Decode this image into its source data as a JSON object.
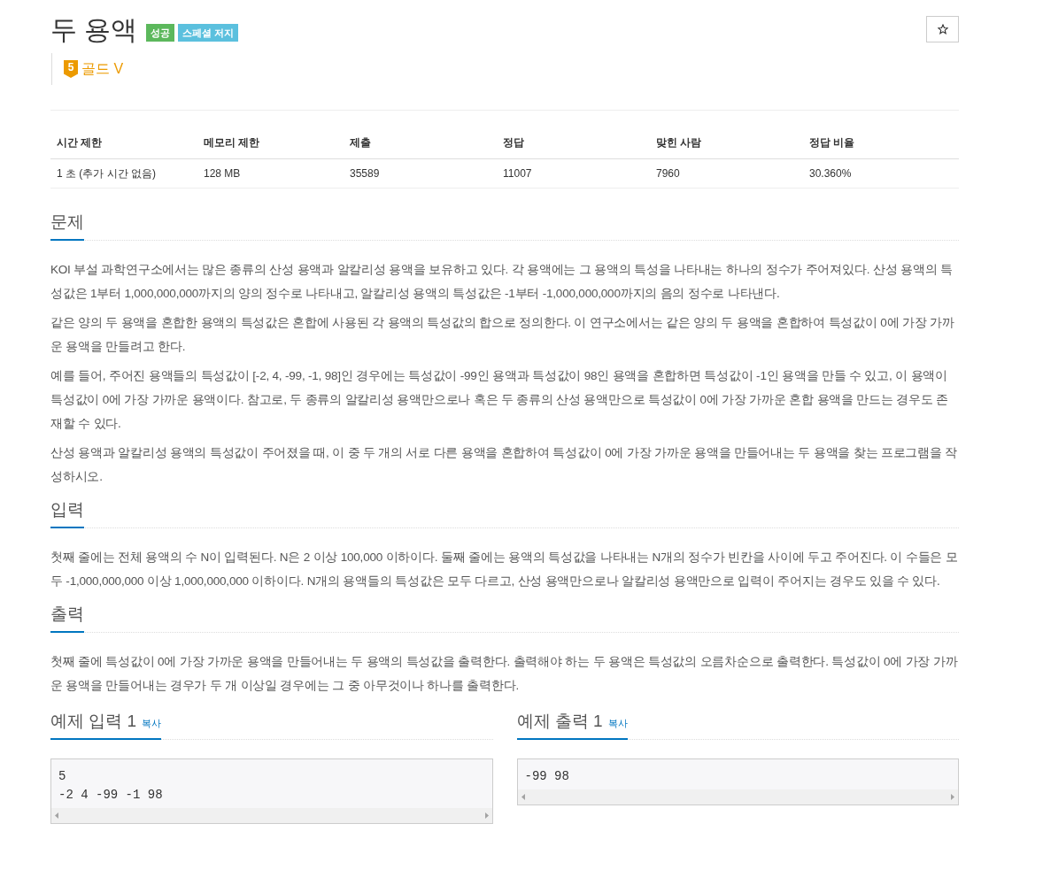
{
  "problem": {
    "title": "두 용액",
    "labels": [
      {
        "text": "성공",
        "color": "#5cb85c"
      },
      {
        "text": "스페셜 저지",
        "color": "#5bc0de"
      }
    ],
    "tier": {
      "number": "5",
      "name": "골드 V"
    },
    "starred": false
  },
  "info_table": {
    "columns": [
      "시간 제한",
      "메모리 제한",
      "제출",
      "정답",
      "맞힌 사람",
      "정답 비율"
    ],
    "rows": [
      [
        "1 초 (추가 시간 없음)",
        "128 MB",
        "35589",
        "11007",
        "7960",
        "30.360%"
      ]
    ]
  },
  "sections": [
    {
      "heading": "문제",
      "paragraphs": [
        "KOI 부설 과학연구소에서는 많은 종류의 산성 용액과 알칼리성 용액을 보유하고 있다. 각 용액에는 그 용액의 특성을 나타내는 하나의 정수가 주어져있다.  산성 용액의 특성값은 1부터 1,000,000,000까지의 양의 정수로 나타내고, 알칼리성 용액의 특성값은 -1부터 -1,000,000,000까지의 음의 정수로 나타낸다.",
        "같은 양의 두 용액을 혼합한 용액의 특성값은 혼합에 사용된 각 용액의 특성값의 합으로 정의한다. 이 연구소에서는 같은 양의 두 용액을 혼합하여 특성값이 0에 가장 가까운 용액을 만들려고 한다.",
        "예를 들어, 주어진 용액들의 특성값이 [-2, 4, -99, -1, 98]인 경우에는 특성값이 -99인 용액과 특성값이 98인 용액을 혼합하면 특성값이 -1인 용액을 만들 수 있고, 이 용액이 특성값이 0에 가장 가까운 용액이다. 참고로, 두 종류의 알칼리성 용액만으로나 혹은 두 종류의 산성 용액만으로 특성값이 0에 가장 가까운 혼합 용액을 만드는 경우도 존재할 수 있다.",
        "산성 용액과 알칼리성 용액의 특성값이 주어졌을 때, 이 중 두 개의 서로 다른 용액을 혼합하여 특성값이 0에 가장 가까운 용액을 만들어내는 두 용액을 찾는 프로그램을 작성하시오."
      ]
    },
    {
      "heading": "입력",
      "paragraphs": [
        "첫째 줄에는 전체 용액의 수 N이 입력된다. N은 2 이상 100,000 이하이다. 둘째 줄에는 용액의 특성값을 나타내는 N개의 정수가 빈칸을 사이에 두고 주어진다. 이 수들은 모두 -1,000,000,000 이상 1,000,000,000 이하이다. N개의 용액들의 특성값은 모두 다르고, 산성 용액만으로나 알칼리성 용액만으로 입력이 주어지는 경우도 있을 수 있다."
      ]
    },
    {
      "heading": "출력",
      "paragraphs": [
        "첫째 줄에 특성값이 0에 가장 가까운 용액을 만들어내는 두 용액의 특성값을 출력한다. 출력해야 하는 두 용액은 특성값의 오름차순으로 출력한다. 특성값이 0에 가장 가까운 용액을 만들어내는 경우가 두 개 이상일 경우에는 그 중 아무것이나 하나를 출력한다."
      ]
    }
  ],
  "samples": [
    {
      "heading": "예제 입력 1",
      "copy": "복사",
      "lines": [
        "5",
        "-2 4 -99 -1 98"
      ]
    },
    {
      "heading": "예제 출력 1",
      "copy": "복사",
      "lines": [
        "-99 98"
      ]
    }
  ]
}
